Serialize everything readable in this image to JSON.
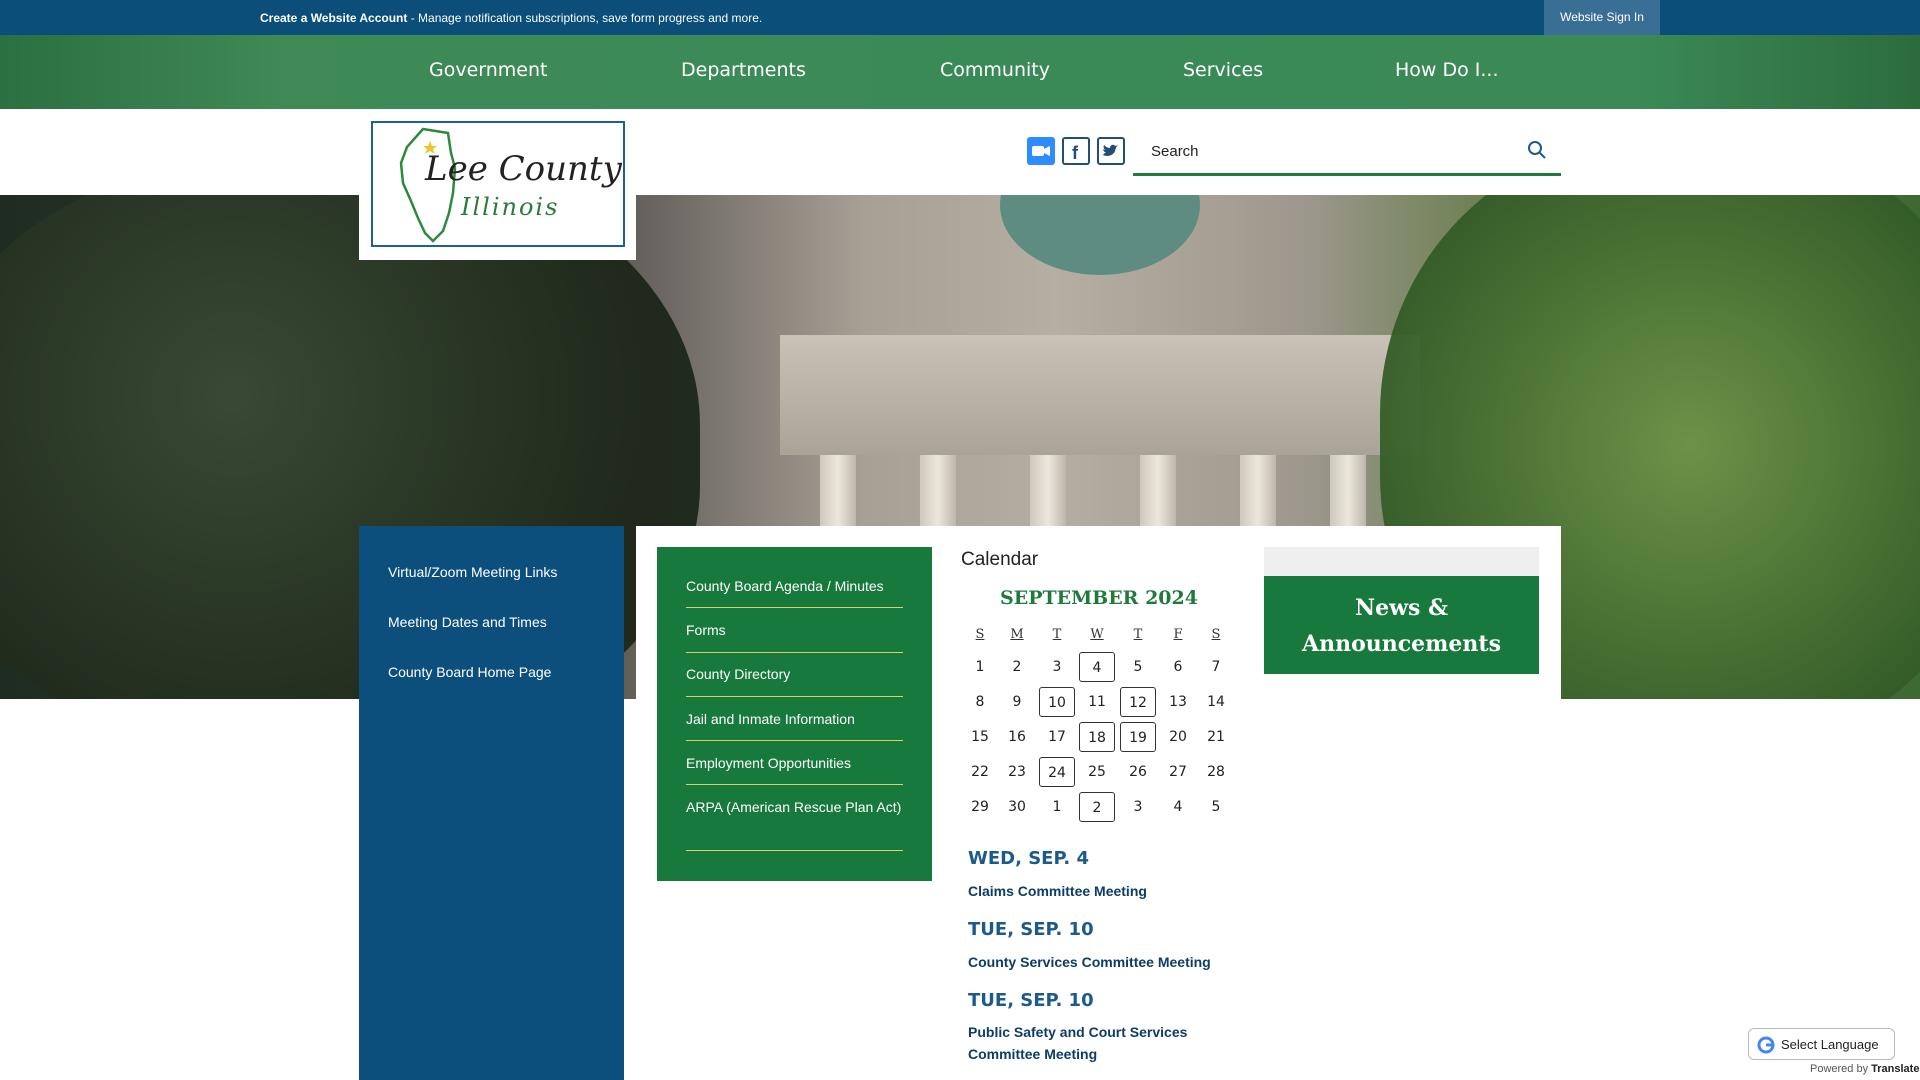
{
  "topbar": {
    "create_account": "Create a Website Account",
    "create_desc": " - Manage notification subscriptions, save form progress and more.",
    "sign_in": "Website Sign In"
  },
  "nav": {
    "items": [
      "Government",
      "Departments",
      "Community",
      "Services",
      "How Do I..."
    ]
  },
  "logo": {
    "title": "Lee County",
    "subtitle": "Illinois"
  },
  "search": {
    "placeholder": "Search"
  },
  "sidebar": {
    "links": [
      "Virtual/Zoom Meeting Links",
      "Meeting Dates and Times",
      "County Board Home Page"
    ]
  },
  "quick_links": [
    "County Board Agenda / Minutes",
    "Forms",
    "County Directory",
    "Jail and Inmate Information",
    "Employment Opportunities",
    "ARPA (American Rescue Plan Act)"
  ],
  "calendar": {
    "heading": "Calendar",
    "month": "SEPTEMBER 2024",
    "days_of_week": [
      "S",
      "M",
      "T",
      "W",
      "T",
      "F",
      "S"
    ],
    "weeks": [
      [
        "1",
        "2",
        "3",
        "4",
        "5",
        "6",
        "7"
      ],
      [
        "8",
        "9",
        "10",
        "11",
        "12",
        "13",
        "14"
      ],
      [
        "15",
        "16",
        "17",
        "18",
        "19",
        "20",
        "21"
      ],
      [
        "22",
        "23",
        "24",
        "25",
        "26",
        "27",
        "28"
      ],
      [
        "29",
        "30",
        "1",
        "2",
        "3",
        "4",
        "5"
      ]
    ],
    "event_days": [
      "4",
      "10",
      "12",
      "18",
      "19",
      "24",
      "2"
    ],
    "events": [
      {
        "date": "WED, SEP. 4",
        "title": "Claims Committee Meeting"
      },
      {
        "date": "TUE, SEP. 10",
        "title": "County Services Committee Meeting"
      },
      {
        "date": "TUE, SEP. 10",
        "title": "Public Safety and Court Services Committee Meeting"
      }
    ]
  },
  "news": {
    "title_line1": "News &",
    "title_line2": "Announcements"
  },
  "translate": {
    "label": "Select Language",
    "powered_by": "Powered by",
    "brand": "Translate"
  },
  "colors": {
    "blue": "#0d4f7c",
    "green": "#177a3c",
    "accent_rule": "#d6d36c"
  }
}
